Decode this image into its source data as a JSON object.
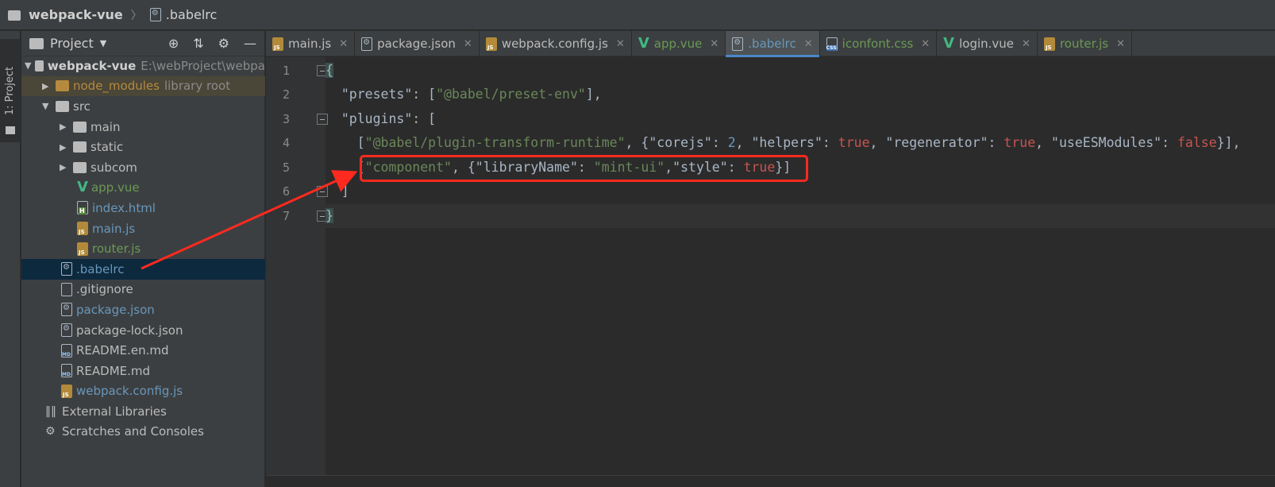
{
  "breadcrumb": {
    "project": "webpack-vue",
    "file": ".babelrc"
  },
  "tool_window": {
    "tab_label": "1: Project"
  },
  "project_panel": {
    "title": "Project",
    "items": [
      {
        "label": "webpack-vue",
        "extra": "E:\\webProject\\webpa"
      },
      {
        "label": "node_modules",
        "extra": "library root"
      },
      {
        "label": "src"
      },
      {
        "label": "main"
      },
      {
        "label": "static"
      },
      {
        "label": "subcom"
      },
      {
        "label": "app.vue"
      },
      {
        "label": "index.html"
      },
      {
        "label": "main.js"
      },
      {
        "label": "router.js"
      },
      {
        "label": ".babelrc"
      },
      {
        "label": ".gitignore"
      },
      {
        "label": "package.json"
      },
      {
        "label": "package-lock.json"
      },
      {
        "label": "README.en.md"
      },
      {
        "label": "README.md"
      },
      {
        "label": "webpack.config.js"
      },
      {
        "label": "External Libraries"
      },
      {
        "label": "Scratches and Consoles"
      }
    ]
  },
  "editor_tabs": [
    {
      "label": "main.js"
    },
    {
      "label": "package.json"
    },
    {
      "label": "webpack.config.js"
    },
    {
      "label": "app.vue"
    },
    {
      "label": ".babelrc"
    },
    {
      "label": "iconfont.css"
    },
    {
      "label": "login.vue"
    },
    {
      "label": "router.js"
    }
  ],
  "editor": {
    "line_numbers": [
      "1",
      "2",
      "3",
      "4",
      "5",
      "6",
      "7"
    ],
    "lines": [
      "{",
      "  \"presets\": [\"@babel/preset-env\"],",
      "  \"plugins\": [",
      "    [\"@babel/plugin-transform-runtime\", {\"corejs\": 2, \"helpers\": true, \"regenerator\": true, \"useESModules\": false}],",
      "    [\"component\", {\"libraryName\": \"mint-ui\",\"style\": true}]",
      "  ]",
      "}"
    ]
  },
  "colors": {
    "highlight_box": "#ff2a1f",
    "arrow": "#ff2a1f",
    "selected_row": "#0d293e",
    "active_tab_underline": "#4a88c7"
  }
}
